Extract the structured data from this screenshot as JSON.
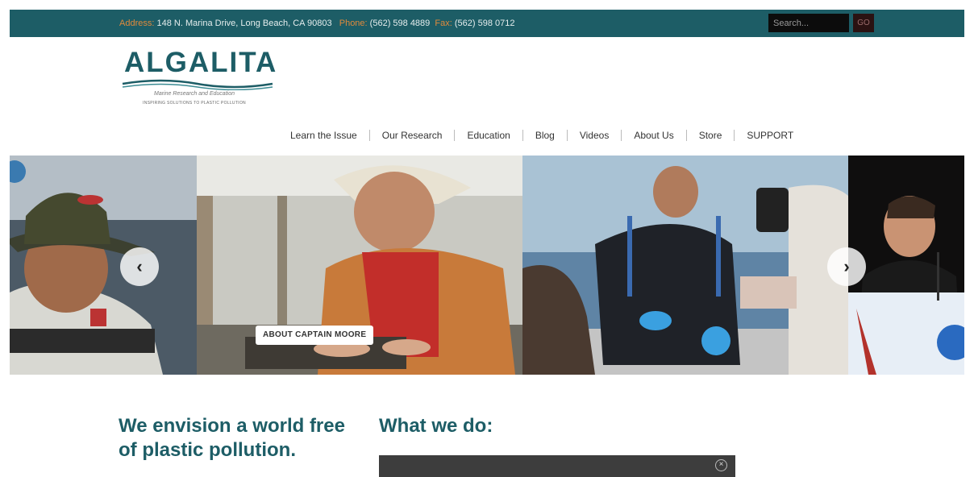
{
  "topbar": {
    "address_label": "Address:",
    "address": "148 N. Marina Drive, Long Beach, CA 90803",
    "phone_label": "Phone:",
    "phone": "(562) 598 4889",
    "fax_label": "Fax:",
    "fax": "(562) 598 0712",
    "search_placeholder": "Search...",
    "go_label": "GO"
  },
  "logo": {
    "name": "ALGALITA",
    "tagline": "Marine Research and Education",
    "subtagline": "INSPIRING SOLUTIONS TO PLASTIC POLLUTION"
  },
  "nav": {
    "items": [
      {
        "label": "Learn the Issue"
      },
      {
        "label": "Our Research"
      },
      {
        "label": "Education"
      },
      {
        "label": "Blog"
      },
      {
        "label": "Videos"
      },
      {
        "label": "About Us"
      },
      {
        "label": "Store"
      },
      {
        "label": "SUPPORT"
      }
    ]
  },
  "slider": {
    "prev_icon": "chevron-left-icon",
    "next_icon": "chevron-right-icon",
    "prev_glyph": "‹",
    "next_glyph": "›",
    "caption_button": "ABOUT CAPTAIN MOORE"
  },
  "main": {
    "vision": "We envision a world free of plastic pollution.",
    "what_we_do": "What we do:",
    "close_glyph": "×"
  },
  "colors": {
    "brand_teal": "#1d5d66",
    "label_orange": "#e08a3c"
  }
}
